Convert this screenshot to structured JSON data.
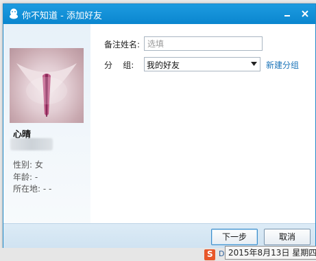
{
  "window": {
    "title": "你不知道 - 添加好友"
  },
  "profile": {
    "nickname": "心晴",
    "gender_label": "性别: 女",
    "age_label": "年龄: -",
    "location_label": "所在地: -  -"
  },
  "form": {
    "remark_label": "备注姓名:",
    "remark_placeholder": "选填",
    "group_label": "分    组:",
    "group_value": "我的好友",
    "new_group_link": "新建分组"
  },
  "buttons": {
    "next": "下一步",
    "cancel": "取消"
  },
  "taskbar": {
    "date_tooltip": "2015年8月13日 星期四",
    "sogou_letter": "S",
    "tray_letter": "D"
  },
  "colors": {
    "titlebar": "#0a86cf",
    "link": "#1a73b8",
    "sogou": "#e8572a"
  },
  "icons": {
    "app": "qq-penguin-icon",
    "minimize": "minimize-icon",
    "close": "close-icon",
    "dropdown": "chevron-down-icon"
  }
}
